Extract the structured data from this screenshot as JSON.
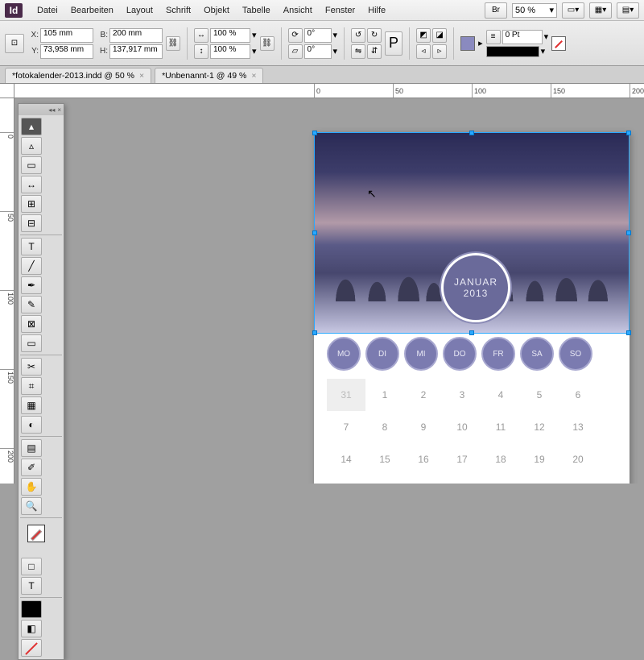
{
  "app": {
    "logo": "Id"
  },
  "menu": {
    "file": "Datei",
    "edit": "Bearbeiten",
    "layout": "Layout",
    "type": "Schrift",
    "object": "Objekt",
    "table": "Tabelle",
    "view": "Ansicht",
    "window": "Fenster",
    "help": "Hilfe",
    "br_label": "Br",
    "zoom": "50 %"
  },
  "control": {
    "x_label": "X:",
    "x": "105 mm",
    "y_label": "Y:",
    "y": "73,958 mm",
    "w_label": "B:",
    "w": "200 mm",
    "h_label": "H:",
    "h": "137,917 mm",
    "scale_x": "100 %",
    "scale_y": "100 %",
    "rot": "0°",
    "shear": "0°",
    "stroke_weight": "0 Pt",
    "fill_color": "#8a8abf"
  },
  "tabs": [
    {
      "title": "*fotokalender-2013.indd @ 50 %"
    },
    {
      "title": "*Unbenannt-1 @ 49 %"
    }
  ],
  "ruler": {
    "h_ticks": [
      "0",
      "50",
      "100",
      "150",
      "200"
    ],
    "v_ticks": [
      "0",
      "50",
      "100",
      "150",
      "200"
    ]
  },
  "calendar": {
    "month": "JANUAR",
    "year": "2013",
    "weekdays": [
      "MO",
      "DI",
      "MI",
      "DO",
      "FR",
      "SA",
      "SO"
    ],
    "prev_day": "31",
    "rows": [
      [
        "31",
        "1",
        "2",
        "3",
        "4",
        "5",
        "6"
      ],
      [
        "7",
        "8",
        "9",
        "10",
        "11",
        "12",
        "13"
      ],
      [
        "14",
        "15",
        "16",
        "17",
        "18",
        "19",
        "20"
      ]
    ]
  }
}
